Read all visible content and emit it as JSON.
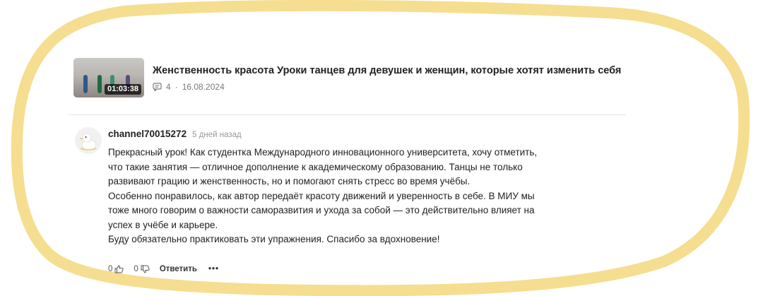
{
  "video": {
    "title": "Женственность красота Уроки танцев для девушек и женщин, которые хотят изменить себя",
    "duration": "01:03:38",
    "comments_count": "4",
    "separator": "·",
    "date": "16.08.2024",
    "thumbnail_icon": "dance-video-thumbnail"
  },
  "comment": {
    "username": "channel70015272",
    "time_ago": "5 дней назад",
    "avatar_icon": "duck-avatar",
    "paragraphs": [
      "Прекрасный урок! Как студентка Международного инновационного университета, хочу отметить, что такие занятия — отличное дополнение к академическому образованию. Танцы не только развивают грацию и женственность, но и помогают снять стресс во время учёбы.",
      "Особенно понравилось, как автор передаёт красоту движений и уверенность в себе. В МИУ мы тоже много говорим о важности саморазвития и ухода за собой — это действительно влияет на успех в учёбе и карьере.",
      "Буду обязательно практиковать эти упражнения. Спасибо за вдохновение!"
    ],
    "likes": "0",
    "dislikes": "0",
    "reply_label": "Ответить",
    "more_label": "•••"
  },
  "colors": {
    "highlight": "#f4dc8a",
    "divider": "#e4e4e4",
    "meta_text": "#7a7a7a"
  }
}
